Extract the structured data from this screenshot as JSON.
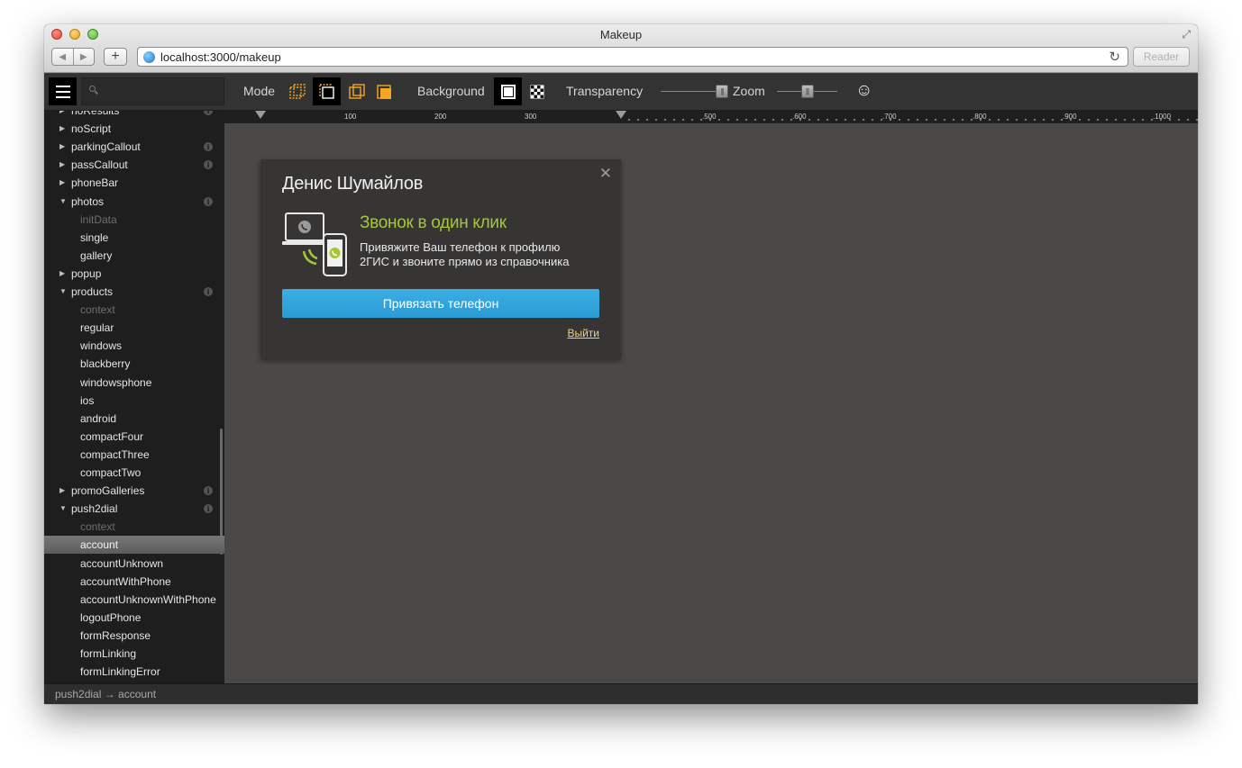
{
  "window": {
    "title": "Makeup"
  },
  "browser": {
    "url": "localhost:3000/makeup",
    "reader_label": "Reader",
    "add_label": "+",
    "back_label": "◀",
    "forward_label": "▶",
    "reload_label": "↻",
    "fullscreen_label": "⤢"
  },
  "toolbar": {
    "search_placeholder": "",
    "mode_label": "Mode",
    "background_label": "Background",
    "transparency_label": "Transparency",
    "zoom_label": "Zoom",
    "transparency_value": 0.4,
    "zoom_value": 0.05,
    "accent_color": "#f5a623",
    "smiley_label": "☺"
  },
  "sidebar": {
    "items": [
      {
        "label": "noResults",
        "level": "parent",
        "arrow": "▶",
        "info": true
      },
      {
        "label": "noScript",
        "level": "parent",
        "arrow": "▶",
        "info": false
      },
      {
        "label": "parkingCallout",
        "level": "parent",
        "arrow": "▶",
        "info": true
      },
      {
        "label": "passCallout",
        "level": "parent",
        "arrow": "▶",
        "info": true
      },
      {
        "label": "phoneBar",
        "level": "parent",
        "arrow": "▶",
        "info": false
      },
      {
        "label": "photos",
        "level": "parent",
        "arrow": "▼",
        "info": true
      },
      {
        "label": "initData",
        "level": "child",
        "muted": true
      },
      {
        "label": "single",
        "level": "child"
      },
      {
        "label": "gallery",
        "level": "child"
      },
      {
        "label": "popup",
        "level": "parent",
        "arrow": "▶",
        "info": false
      },
      {
        "label": "products",
        "level": "parent",
        "arrow": "▼",
        "info": true
      },
      {
        "label": "context",
        "level": "child",
        "muted": true
      },
      {
        "label": "regular",
        "level": "child"
      },
      {
        "label": "windows",
        "level": "child"
      },
      {
        "label": "blackberry",
        "level": "child"
      },
      {
        "label": "windowsphone",
        "level": "child"
      },
      {
        "label": "ios",
        "level": "child"
      },
      {
        "label": "android",
        "level": "child"
      },
      {
        "label": "compactFour",
        "level": "child"
      },
      {
        "label": "compactThree",
        "level": "child"
      },
      {
        "label": "compactTwo",
        "level": "child"
      },
      {
        "label": "promoGalleries",
        "level": "parent",
        "arrow": "▶",
        "info": true
      },
      {
        "label": "push2dial",
        "level": "parent",
        "arrow": "▼",
        "info": true
      },
      {
        "label": "context",
        "level": "child",
        "muted": true
      },
      {
        "label": "account",
        "level": "child",
        "selected": true
      },
      {
        "label": "accountUnknown",
        "level": "child"
      },
      {
        "label": "accountWithPhone",
        "level": "child"
      },
      {
        "label": "accountUnknownWithPhone",
        "level": "child"
      },
      {
        "label": "logoutPhone",
        "level": "child"
      },
      {
        "label": "formResponse",
        "level": "child"
      },
      {
        "label": "formLinking",
        "level": "child"
      },
      {
        "label": "formLinkingError",
        "level": "child"
      }
    ]
  },
  "ruler": {
    "ticks": [
      "100",
      "200",
      "300",
      ".500",
      ".600",
      ".700",
      ".800",
      ".900",
      ".1000"
    ]
  },
  "status": {
    "path": "push2dial → account"
  },
  "card": {
    "close_label": "✕",
    "title": "Денис Шумайлов",
    "heading": "Звонок в один клик",
    "desc_line1": "Привяжите Ваш телефон к профилю",
    "desc_line2": "2ГИС и звоните прямо из справочника",
    "button_label": "Привязать телефон",
    "logout_label": "Выйти",
    "accent_color": "#a4c639",
    "button_color": "#33a6dd"
  }
}
